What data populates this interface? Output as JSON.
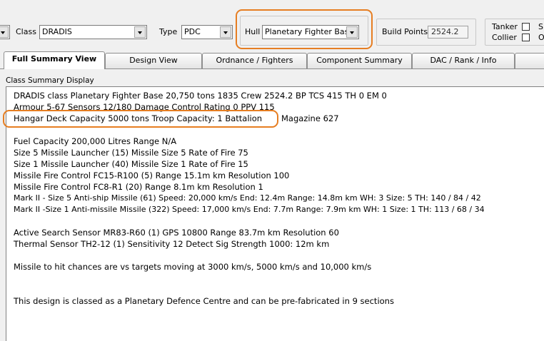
{
  "toolbar": {
    "class_label": "Class",
    "class_value": "DRADIS",
    "type_label": "Type",
    "type_value": "PDC",
    "hull_label": "Hull",
    "hull_value": "Planetary Fighter Base",
    "build_points_label": "Build Points",
    "build_points_value": "2524.2",
    "tanker_label": "Tanker",
    "collier_label": "Collier",
    "tanker_checked": false,
    "collier_checked": false,
    "cut_label_1": "S",
    "cut_label_2": "O"
  },
  "tabs": [
    {
      "label": "Full Summary View",
      "active": true
    },
    {
      "label": "Design View",
      "active": false
    },
    {
      "label": "Ordnance / Fighters",
      "active": false
    },
    {
      "label": "Component Summary",
      "active": false
    },
    {
      "label": "DAC / Rank / Info",
      "active": false
    }
  ],
  "section_label": "Class Summary Display",
  "highlight_color": "#e67e22",
  "summary": {
    "line1": "DRADIS class Planetary Fighter Base      20,750 tons       1835 Crew       2524.2 BP       TCS 415   TH 0   EM 0",
    "line2": "Armour 5-67       Sensors 12/180       Damage Control Rating 0       PPV 115",
    "line3a": "Hangar Deck Capacity 5000 tons     Troop Capacity: 1 Battalion",
    "line3b": "Magazine 627",
    "line4": "Fuel Capacity 200,000 Litres     Range N/A",
    "line5": "Size 5 Missile Launcher (15)      Missile Size 5      Rate of Fire 75",
    "line6": "Size 1 Missile Launcher (40)      Missile Size 1      Rate of Fire 15",
    "line7": "Missile Fire Control FC15-R100 (5)      Range 15.1m km      Resolution 100",
    "line8": "Missile Fire Control FC8-R1 (20)      Range 8.1m km      Resolution 1",
    "line9": "Mark II - Size 5 Anti-ship Missile (61)  Speed: 20,000 km/s   End: 12.4m    Range: 14.8m km    WH: 3    Size: 5    TH: 140 / 84 / 42",
    "line10": "Mark II -Size 1 Anti-missile Missile (322)  Speed: 17,000 km/s   End: 7.7m    Range: 7.9m km   WH: 1    Size: 1    TH: 113 / 68 / 34",
    "line11": "Active Search Sensor MR83-R60 (1)      GPS 10800      Range 83.7m km      Resolution 60",
    "line12": "Thermal Sensor TH2-12 (1)       Sensitivity 12       Detect Sig Strength 1000:  12m km",
    "line13": "Missile to hit chances are vs targets moving at 3000 km/s, 5000 km/s and 10,000 km/s",
    "line14": "This design is classed as a Planetary Defence Centre and can be pre-fabricated in 9 sections"
  }
}
